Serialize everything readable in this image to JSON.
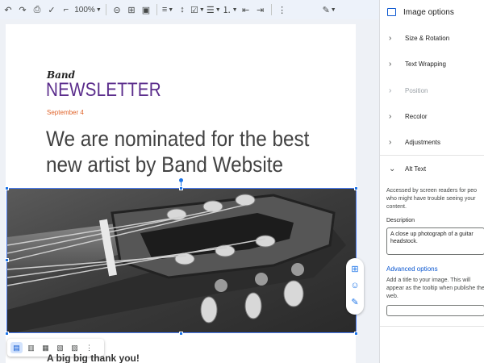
{
  "toolbar": {
    "zoom": "100%",
    "icons": [
      "undo-icon",
      "redo-icon",
      "print-icon",
      "spellcheck-icon",
      "paint-format-icon",
      "link-icon",
      "comment-icon",
      "image-icon",
      "align-icon",
      "line-spacing-icon",
      "checklist-icon",
      "bullets-icon",
      "numbered-list-icon",
      "indent-decrease-icon",
      "indent-increase-icon",
      "more-icon",
      "pen-icon"
    ]
  },
  "document": {
    "brand": "Band",
    "newsletter": "NEWSLETTER",
    "date": "September 4",
    "headline": "We are nominated for the best new artist by Band Website",
    "subheading": "A big big thank you!"
  },
  "image_toolbar": {
    "icons": [
      "inline-icon",
      "wrap-text-icon",
      "break-text-icon",
      "behind-text-icon",
      "in-front-icon",
      "more-vert-icon"
    ]
  },
  "side_actions": [
    "add-comment-icon",
    "emoji-icon",
    "suggest-edit-icon"
  ],
  "panel": {
    "title": "Image options",
    "sections": [
      {
        "label": "Size & Rotation",
        "state": "collapsed"
      },
      {
        "label": "Text Wrapping",
        "state": "collapsed"
      },
      {
        "label": "Position",
        "state": "disabled"
      },
      {
        "label": "Recolor",
        "state": "collapsed"
      },
      {
        "label": "Adjustments",
        "state": "collapsed"
      },
      {
        "label": "Alt Text",
        "state": "expanded"
      }
    ],
    "alt_text": {
      "description_help": "Accessed by screen readers for peo who might have trouble seeing your content.",
      "description_label": "Description",
      "description_value": "A close up photograph of a guitar headstock.",
      "advanced_label": "Advanced options",
      "advanced_help": "Add a title to your image. This will appear as the tooltip when publishe the web.",
      "title_value": ""
    }
  },
  "colors": {
    "accent": "#1a73e8",
    "newsletter": "#5b2d8c",
    "date": "#e0642b",
    "toolbar_bg": "#edf2fa"
  }
}
